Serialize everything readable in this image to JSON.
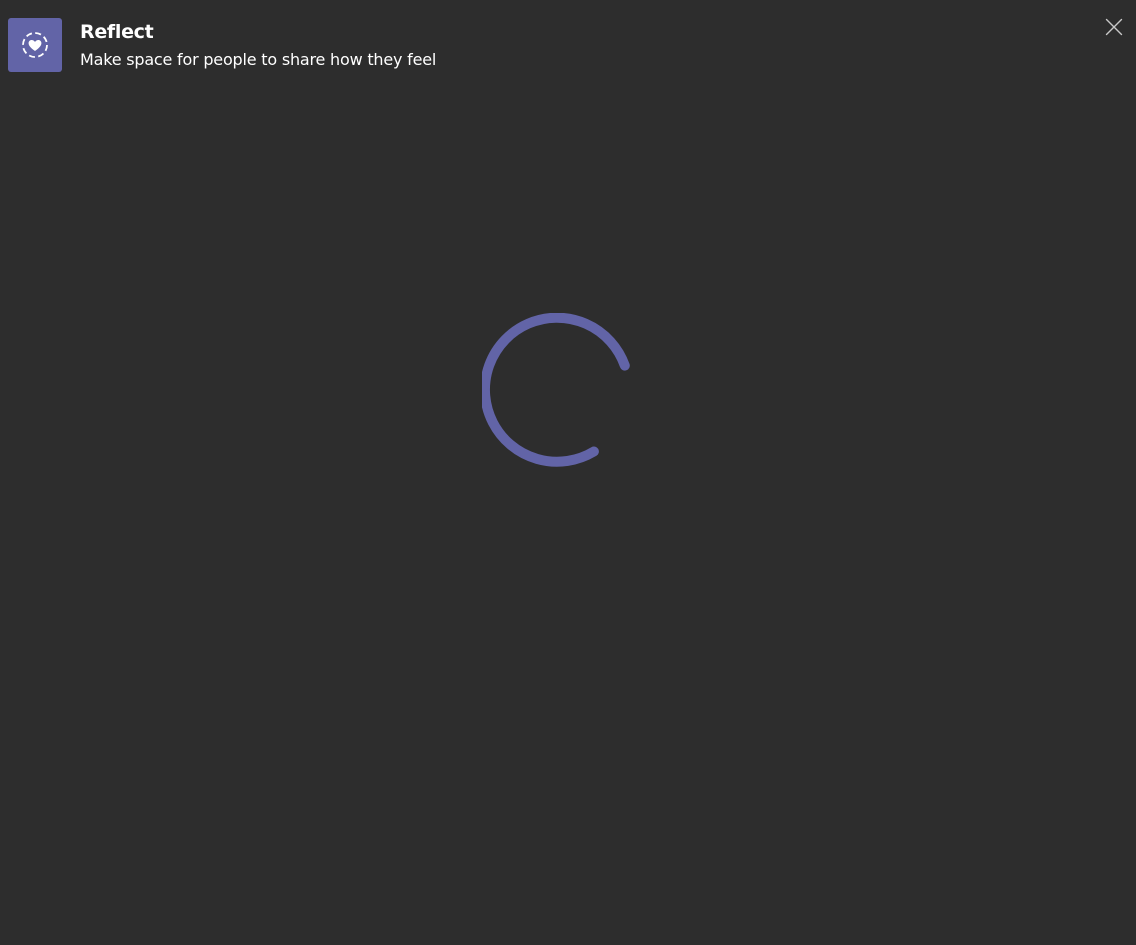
{
  "header": {
    "title": "Reflect",
    "subtitle": "Make space for people to share how they feel",
    "icon": "reflect-heart-icon",
    "close_icon": "close-icon"
  },
  "loading": {
    "icon": "loading-spinner-icon"
  },
  "colors": {
    "background": "#2d2d2d",
    "accent": "#6264a7",
    "text": "#ffffff"
  }
}
